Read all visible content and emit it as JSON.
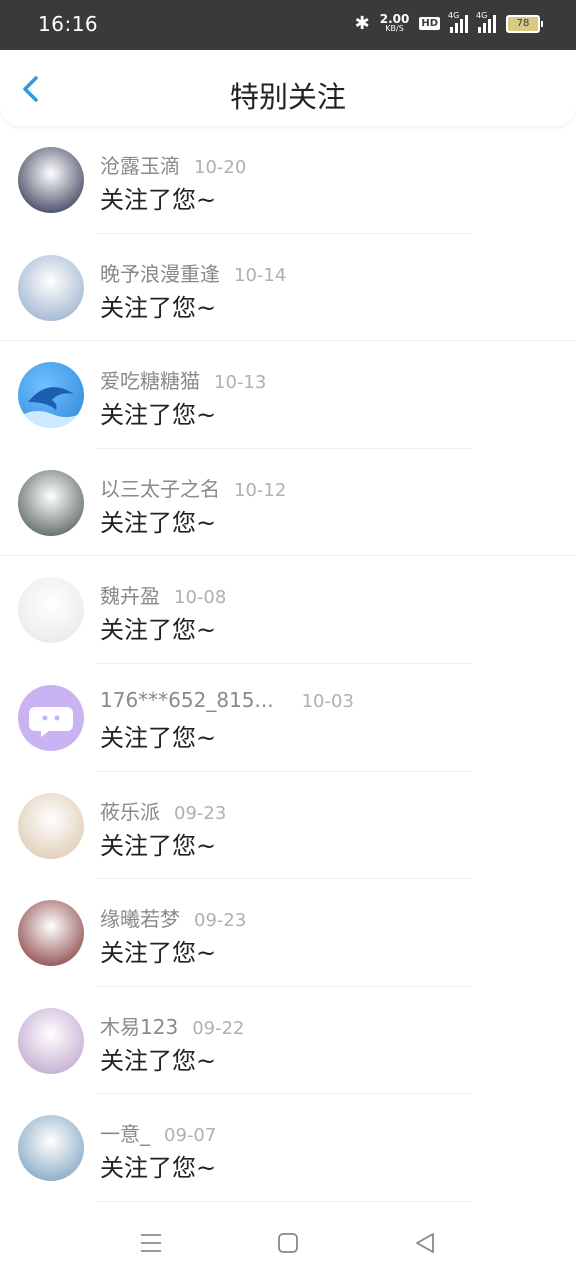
{
  "status_bar": {
    "time": "16:16",
    "speed_value": "2.00",
    "speed_unit": "KB/S",
    "hd_label": "HD",
    "net1": "4G",
    "net2": "4G",
    "battery": "78"
  },
  "header": {
    "title": "特别关注"
  },
  "items": [
    {
      "name": "沧露玉滴",
      "date": "10-20",
      "message": "关注了您~",
      "avatar_color": "#1a2140"
    },
    {
      "name": "晚予浪漫重逢",
      "date": "10-14",
      "message": "关注了您~",
      "avatar_color": "#8ea7c7"
    },
    {
      "name": "爱吃糖糖猫",
      "date": "10-13",
      "message": "关注了您~",
      "avatar_color": "#2f86d8"
    },
    {
      "name": "以三太子之名",
      "date": "10-12",
      "message": "关注了您~",
      "avatar_color": "#3d4a4a"
    },
    {
      "name": "魏卉盈",
      "date": "10-08",
      "message": "关注了您~",
      "avatar_color": "#e9e4e4"
    },
    {
      "name": "176***652_815...",
      "date": "10-03",
      "message": "关注了您~",
      "avatar_color": "#c9b3f2"
    },
    {
      "name": "莜乐派",
      "date": "09-23",
      "message": "关注了您~",
      "avatar_color": "#d9c2a6"
    },
    {
      "name": "缘曦若梦",
      "date": "09-23",
      "message": "关注了您~",
      "avatar_color": "#7a2a2a"
    },
    {
      "name": "木易123",
      "date": "09-22",
      "message": "关注了您~",
      "avatar_color": "#b79ac7"
    },
    {
      "name": "一意_",
      "date": "09-07",
      "message": "关注了您~",
      "avatar_color": "#6f98b8"
    }
  ],
  "colors": {
    "accent": "#2f9be5",
    "status_bar": "#3a3a3a"
  }
}
